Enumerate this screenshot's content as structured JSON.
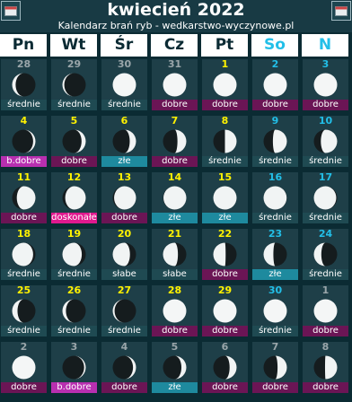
{
  "title": "kwiecień 2022",
  "subtitle": "Kalendarz brań ryb - wedkarstwo-wyczynowe.pl",
  "nav": {
    "prev_icon": "calendar-prev-icon",
    "next_icon": "calendar-next-icon"
  },
  "days": [
    "Pn",
    "Wt",
    "Śr",
    "Cz",
    "Pt",
    "So",
    "N"
  ],
  "colors": {
    "weekday": "#0a2a33",
    "weekend": "#22bfe8",
    "current_month_num": "#fff200",
    "other_month_num": "#9aa6aa"
  },
  "weeks": [
    [
      {
        "day": "28",
        "label": "średnie",
        "illum": 0.15,
        "waxing": false,
        "type": "srednie",
        "other": true
      },
      {
        "day": "29",
        "label": "średnie",
        "illum": 0.08,
        "waxing": false,
        "type": "srednie",
        "other": true
      },
      {
        "day": "30",
        "label": "średnie",
        "illum": 0.03,
        "waxing": false,
        "type": "srednie",
        "other": true
      },
      {
        "day": "31",
        "label": "dobre",
        "illum": 0.0,
        "waxing": false,
        "type": "dobre",
        "other": true
      },
      {
        "day": "1",
        "label": "dobre",
        "illum": 0.0,
        "waxing": true,
        "type": "dobre",
        "other": false
      },
      {
        "day": "2",
        "label": "dobre",
        "illum": 0.02,
        "waxing": true,
        "type": "dobre",
        "other": false
      },
      {
        "day": "3",
        "label": "dobre",
        "illum": 0.05,
        "waxing": true,
        "type": "dobre",
        "other": false
      }
    ],
    [
      {
        "day": "4",
        "label": "b.dobre",
        "illum": 0.1,
        "waxing": true,
        "type": "bdobre",
        "other": false
      },
      {
        "day": "5",
        "label": "dobre",
        "illum": 0.18,
        "waxing": true,
        "type": "dobre",
        "other": false
      },
      {
        "day": "6",
        "label": "złe",
        "illum": 0.27,
        "waxing": true,
        "type": "zle",
        "other": false
      },
      {
        "day": "7",
        "label": "dobre",
        "illum": 0.38,
        "waxing": true,
        "type": "dobre",
        "other": false
      },
      {
        "day": "8",
        "label": "średnie",
        "illum": 0.5,
        "waxing": true,
        "type": "srednie",
        "other": false
      },
      {
        "day": "9",
        "label": "średnie",
        "illum": 0.6,
        "waxing": true,
        "type": "srednie",
        "other": false
      },
      {
        "day": "10",
        "label": "średnie",
        "illum": 0.7,
        "waxing": true,
        "type": "srednie",
        "other": false
      }
    ],
    [
      {
        "day": "11",
        "label": "dobre",
        "illum": 0.8,
        "waxing": true,
        "type": "dobre",
        "other": false
      },
      {
        "day": "12",
        "label": "doskonałe",
        "illum": 0.88,
        "waxing": true,
        "type": "dosk",
        "other": false
      },
      {
        "day": "13",
        "label": "dobre",
        "illum": 0.94,
        "waxing": true,
        "type": "dobre",
        "other": false
      },
      {
        "day": "14",
        "label": "złe",
        "illum": 0.98,
        "waxing": true,
        "type": "zle",
        "other": false
      },
      {
        "day": "15",
        "label": "złe",
        "illum": 1.0,
        "waxing": true,
        "type": "zle",
        "other": false
      },
      {
        "day": "16",
        "label": "średnie",
        "illum": 0.99,
        "waxing": false,
        "type": "srednie",
        "other": false
      },
      {
        "day": "17",
        "label": "średnie",
        "illum": 0.96,
        "waxing": false,
        "type": "srednie",
        "other": false
      }
    ],
    [
      {
        "day": "18",
        "label": "średnie",
        "illum": 0.9,
        "waxing": false,
        "type": "srednie",
        "other": false
      },
      {
        "day": "19",
        "label": "średnie",
        "illum": 0.83,
        "waxing": false,
        "type": "srednie",
        "other": false
      },
      {
        "day": "20",
        "label": "słabe",
        "illum": 0.74,
        "waxing": false,
        "type": "slabe",
        "other": false
      },
      {
        "day": "21",
        "label": "słabe",
        "illum": 0.64,
        "waxing": false,
        "type": "slabe",
        "other": false
      },
      {
        "day": "22",
        "label": "dobre",
        "illum": 0.53,
        "waxing": false,
        "type": "dobre",
        "other": false
      },
      {
        "day": "23",
        "label": "złe",
        "illum": 0.42,
        "waxing": false,
        "type": "zle",
        "other": false
      },
      {
        "day": "24",
        "label": "średnie",
        "illum": 0.32,
        "waxing": false,
        "type": "srednie",
        "other": false
      }
    ],
    [
      {
        "day": "25",
        "label": "średnie",
        "illum": 0.23,
        "waxing": false,
        "type": "srednie",
        "other": false
      },
      {
        "day": "26",
        "label": "średnie",
        "illum": 0.15,
        "waxing": false,
        "type": "srednie",
        "other": false
      },
      {
        "day": "27",
        "label": "średnie",
        "illum": 0.08,
        "waxing": false,
        "type": "srednie",
        "other": false
      },
      {
        "day": "28",
        "label": "dobre",
        "illum": 0.03,
        "waxing": false,
        "type": "dobre",
        "other": false
      },
      {
        "day": "29",
        "label": "dobre",
        "illum": 0.0,
        "waxing": false,
        "type": "dobre",
        "other": false
      },
      {
        "day": "30",
        "label": "średnie",
        "illum": 0.0,
        "waxing": true,
        "type": "srednie",
        "other": false
      },
      {
        "day": "1",
        "label": "dobre",
        "illum": 0.0,
        "waxing": true,
        "type": "dobre",
        "other": true
      }
    ],
    [
      {
        "day": "2",
        "label": "dobre",
        "illum": 0.03,
        "waxing": true,
        "type": "dobre",
        "other": true
      },
      {
        "day": "3",
        "label": "b.dobre",
        "illum": 0.07,
        "waxing": true,
        "type": "bdobre",
        "other": true
      },
      {
        "day": "4",
        "label": "dobre",
        "illum": 0.13,
        "waxing": true,
        "type": "dobre",
        "other": true
      },
      {
        "day": "5",
        "label": "złe",
        "illum": 0.21,
        "waxing": true,
        "type": "zle",
        "other": true
      },
      {
        "day": "6",
        "label": "dobre",
        "illum": 0.3,
        "waxing": true,
        "type": "dobre",
        "other": true
      },
      {
        "day": "7",
        "label": "dobre",
        "illum": 0.4,
        "waxing": true,
        "type": "dobre",
        "other": true
      },
      {
        "day": "8",
        "label": "dobre",
        "illum": 0.52,
        "waxing": true,
        "type": "dobre",
        "other": true
      }
    ]
  ]
}
